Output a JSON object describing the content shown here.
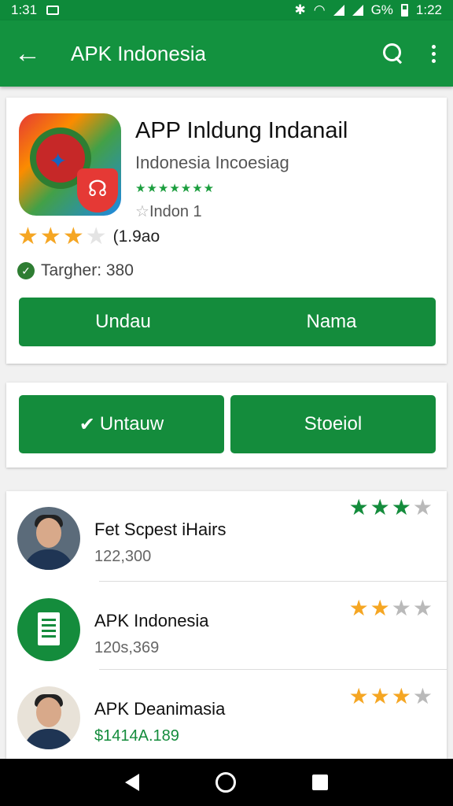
{
  "status_bar": {
    "time": "1:31",
    "battery": "G%",
    "clock_right": "1:22"
  },
  "app_bar": {
    "title": "APK Indonesia",
    "icons": [
      "back-arrow-icon",
      "search-icon",
      "more-vert-icon"
    ]
  },
  "app_card": {
    "title": "APP Inldung Indanail",
    "developer": "Indonesia Incoesiag",
    "mini_stars": "★★★★★★★",
    "installs": "Indon 1",
    "rating_stars": 3,
    "rating_count": "(1.9ao",
    "target": "Targher: 380",
    "button_left": "Undau",
    "button_right": "Nama"
  },
  "action_buttons": {
    "left": "Untauw",
    "right": "Stoeiol"
  },
  "list": [
    {
      "name": "Fet Scpest iHairs",
      "sub": "122,300",
      "stars": 3,
      "star_color": "green",
      "avatar": "person-photo"
    },
    {
      "name": "APK Indonesia",
      "sub": "120s,369",
      "stars": 2,
      "star_color": "gold",
      "avatar": "document-icon"
    },
    {
      "name": "APK Deanimasia",
      "sub": "$1414A.189",
      "stars": 3,
      "star_color": "gold",
      "avatar": "person-photo"
    }
  ],
  "colors": {
    "status_bar": "#0e8a3a",
    "app_bar": "#13923f",
    "button": "#148c3c",
    "star_gold": "#f5a623"
  }
}
